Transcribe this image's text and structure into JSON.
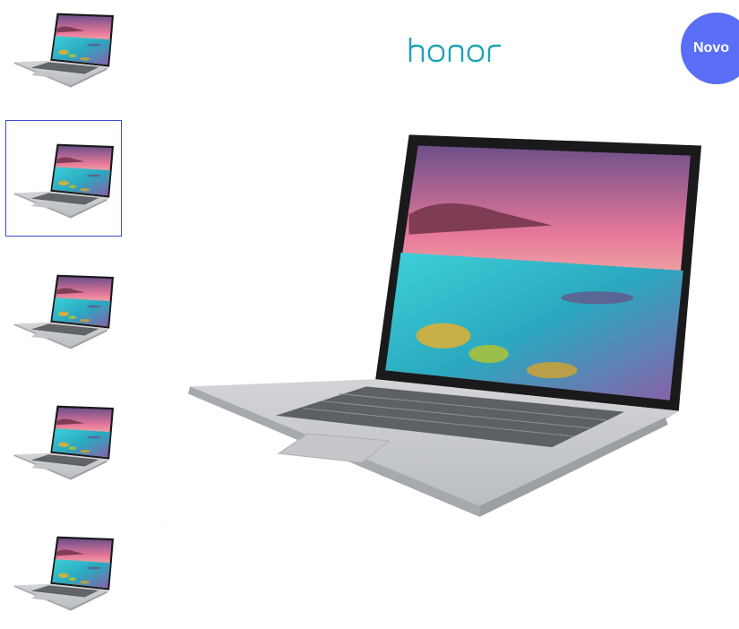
{
  "brand": {
    "name": "honor",
    "color": "#1aa2b6"
  },
  "badge": {
    "label": "Novo",
    "color": "#5b6ef6"
  },
  "gallery": {
    "thumbnails": [
      {
        "icon": "laptop-thumbnail",
        "selected": false
      },
      {
        "icon": "laptop-thumbnail",
        "selected": true
      },
      {
        "icon": "laptop-thumbnail",
        "selected": false
      },
      {
        "icon": "laptop-thumbnail",
        "selected": false
      },
      {
        "icon": "laptop-thumbnail",
        "selected": false
      }
    ],
    "selected_index": 1,
    "selection_color": "#3a4cc9"
  },
  "main_image": {
    "icon": "laptop-product-image"
  }
}
